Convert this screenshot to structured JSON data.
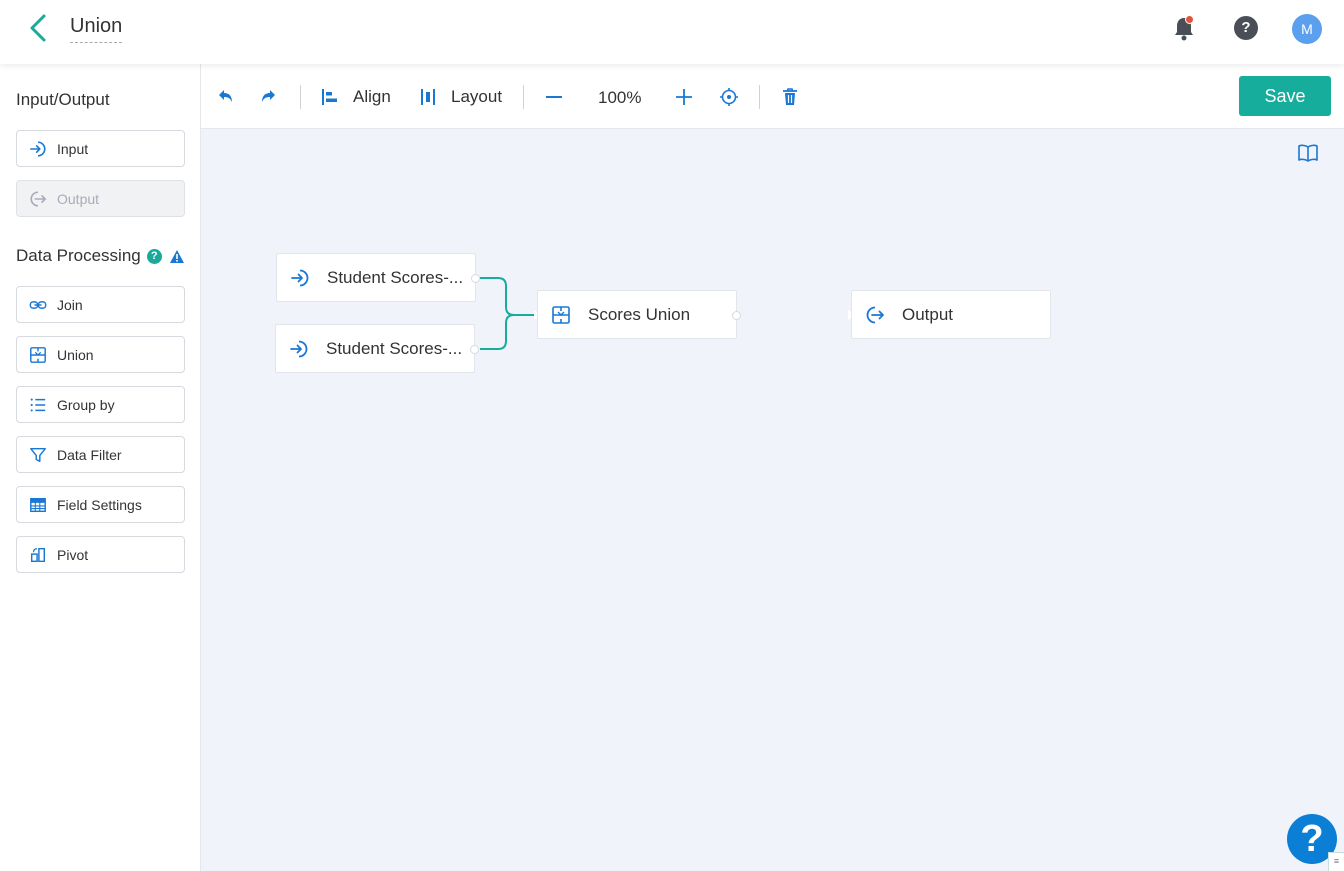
{
  "header": {
    "title": "Union",
    "avatar_initial": "M",
    "help_glyph": "?",
    "icons": [
      "back-chevron-icon",
      "bell-icon",
      "help-icon"
    ]
  },
  "sidebar": {
    "input_output_title": "Input/Output",
    "io_items": [
      {
        "label": "Input",
        "icon": "input-arrow-icon",
        "disabled": false
      },
      {
        "label": "Output",
        "icon": "output-arrow-icon",
        "disabled": true
      }
    ],
    "data_processing_title": "Data Processing",
    "dp_help_glyph": "?",
    "dp_items": [
      {
        "label": "Join",
        "icon": "link-icon"
      },
      {
        "label": "Union",
        "icon": "union-icon"
      },
      {
        "label": "Group by",
        "icon": "list-icon"
      },
      {
        "label": "Data Filter",
        "icon": "filter-icon"
      },
      {
        "label": "Field Settings",
        "icon": "table-icon"
      },
      {
        "label": "Pivot",
        "icon": "pivot-icon"
      }
    ]
  },
  "toolbar": {
    "align_label": "Align",
    "layout_label": "Layout",
    "zoom": "100%",
    "save_label": "Save"
  },
  "canvas": {
    "nodes": [
      {
        "label": "Student Scores-...",
        "type": "input"
      },
      {
        "label": "Student Scores-...",
        "type": "input"
      },
      {
        "label": "Scores Union",
        "type": "union"
      },
      {
        "label": "Output",
        "type": "output"
      }
    ]
  },
  "floating_help": "?",
  "colors": {
    "accent": "#17ad9c",
    "icon_blue": "#1a78d4",
    "canvas_bg": "#f0f3fa",
    "notification_dot": "#e0533d",
    "avatar_bg": "#5aa0ee"
  }
}
